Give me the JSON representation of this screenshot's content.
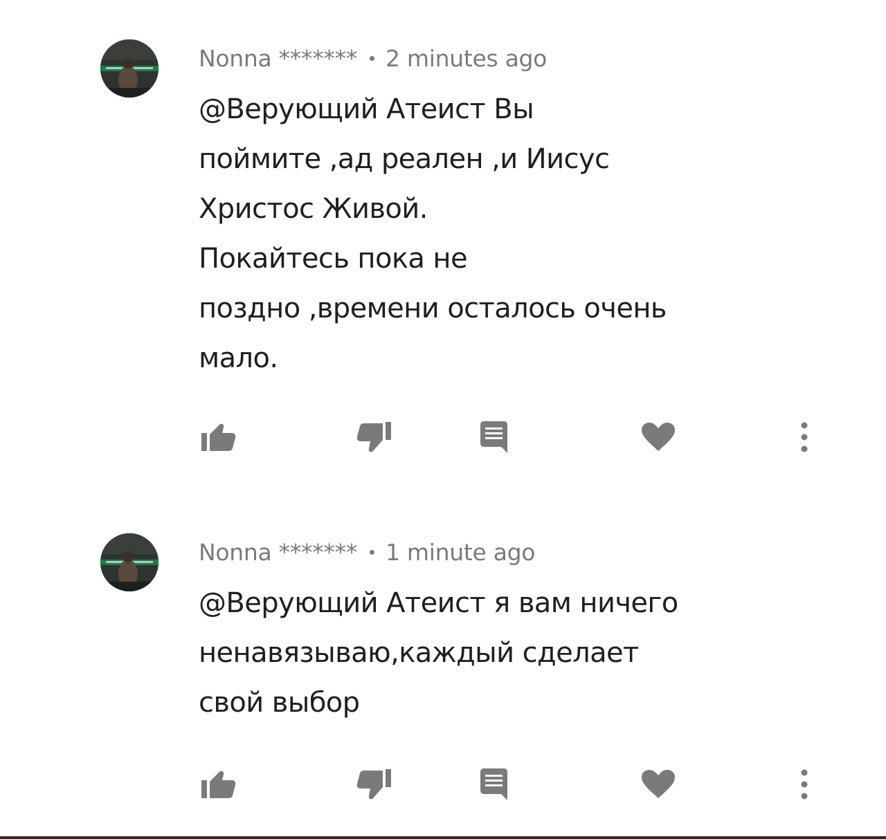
{
  "comments": [
    {
      "author": "Nonna *******",
      "time": "2 minutes ago",
      "lines": [
        "@Верующий Атеист Вы",
        "поймите ,ад реален ,и Иисус",
        "Христос Живой.",
        "Покайтесь пока не",
        "поздно ,времени осталось очень",
        "мало."
      ]
    },
    {
      "author": "Nonna *******",
      "time": "1 minute ago",
      "lines": [
        "@Верующий Атеист я вам ничего",
        "ненавязываю,каждый сделает",
        "свой выбор"
      ]
    }
  ],
  "icons": {
    "like": "thumb-up-icon",
    "dislike": "thumb-down-icon",
    "reply": "comment-icon",
    "heart": "heart-icon",
    "more": "more-vertical-icon"
  },
  "colors": {
    "icon": "#7a7a7a",
    "meta": "#7a7a7a",
    "text": "#1f1f1f",
    "avatar_band": "#1f7a4a"
  }
}
